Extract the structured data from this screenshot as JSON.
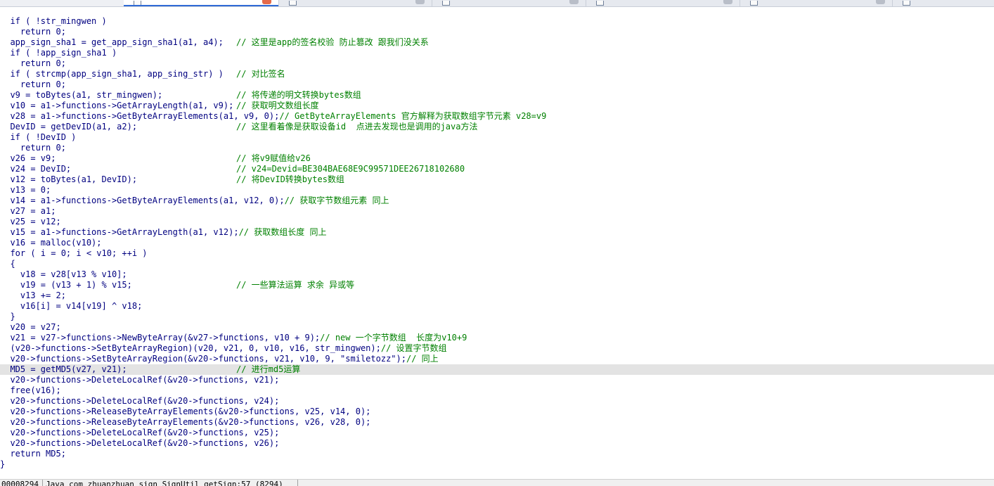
{
  "tabs": [
    {
      "label": "",
      "active": true
    },
    {
      "label": "",
      "active": false
    },
    {
      "label": "",
      "active": false
    },
    {
      "label": "",
      "active": false
    },
    {
      "label": "",
      "active": false
    },
    {
      "label": "",
      "active": false
    }
  ],
  "code_lines": [
    {
      "code": "  if ( !str_mingwen )",
      "comment": ""
    },
    {
      "code": "    return 0;",
      "comment": ""
    },
    {
      "code": "  app_sign_sha1 = get_app_sign_sha1(a1, a4);",
      "comment": "// 这里是app的签名校验 防止篡改 跟我们没关系"
    },
    {
      "code": "  if ( !app_sign_sha1 )",
      "comment": ""
    },
    {
      "code": "    return 0;",
      "comment": ""
    },
    {
      "code": "  if ( strcmp(app_sign_sha1, app_sing_str) )",
      "comment": "// 对比签名"
    },
    {
      "code": "    return 0;",
      "comment": ""
    },
    {
      "code": "  v9 = toBytes(a1, str_mingwen);",
      "comment": "// 将传递的明文转换bytes数组"
    },
    {
      "code": "  v10 = a1->functions->GetArrayLength(a1, v9);",
      "comment": "// 获取明文数组长度"
    },
    {
      "code": "  v28 = a1->functions->GetByteArrayElements(a1, v9, 0);",
      "comment": "// GetByteArrayElements 官方解释为获取数组字节元素 v28=v9",
      "near": true
    },
    {
      "code": "  DevID = getDevID(a1, a2);",
      "comment": "// 这里看着像是获取设备id  点进去发现也是调用的java方法"
    },
    {
      "code": "  if ( !DevID )",
      "comment": ""
    },
    {
      "code": "    return 0;",
      "comment": ""
    },
    {
      "code": "  v26 = v9;",
      "comment": "// 将v9赋值给v26"
    },
    {
      "code": "  v24 = DevID;",
      "comment": "// v24=Devid=BE304BAE68E9C99571DEE26718102680"
    },
    {
      "code": "  v12 = toBytes(a1, DevID);",
      "comment": "// 将DevID转换bytes数组"
    },
    {
      "code": "  v13 = 0;",
      "comment": ""
    },
    {
      "code": "  v14 = a1->functions->GetByteArrayElements(a1, v12, 0);",
      "comment": "// 获取字节数组元素 同上",
      "near": true
    },
    {
      "code": "  v27 = a1;",
      "comment": ""
    },
    {
      "code": "  v25 = v12;",
      "comment": ""
    },
    {
      "code": "  v15 = a1->functions->GetArrayLength(a1, v12);",
      "comment": "// 获取数组长度 同上",
      "near": true
    },
    {
      "code": "  v16 = malloc(v10);",
      "comment": ""
    },
    {
      "code": "  for ( i = 0; i < v10; ++i )",
      "comment": ""
    },
    {
      "code": "  {",
      "comment": ""
    },
    {
      "code": "    v18 = v28[v13 % v10];",
      "comment": ""
    },
    {
      "code": "    v19 = (v13 + 1) % v15;",
      "comment": "// 一些算法运算 求余 异或等"
    },
    {
      "code": "    v13 += 2;",
      "comment": ""
    },
    {
      "code": "    v16[i] = v14[v19] ^ v18;",
      "comment": ""
    },
    {
      "code": "  }",
      "comment": ""
    },
    {
      "code": "  v20 = v27;",
      "comment": ""
    },
    {
      "code": "  v21 = v27->functions->NewByteArray(&v27->functions, v10 + 9);",
      "comment": "// new 一个字节数组  长度为v10+9",
      "near": true
    },
    {
      "code": "  (v20->functions->SetByteArrayRegion)(v20, v21, 0, v10, v16, str_mingwen);",
      "comment": "// 设置字节数组",
      "near": true
    },
    {
      "code": "  v20->functions->SetByteArrayRegion(&v20->functions, v21, v10, 9, \"smiletozz\");",
      "comment": "// 同上",
      "near": true
    },
    {
      "code": "  MD5 = getMD5(v27, v21);",
      "comment": "// 进行md5运算",
      "highlight": true
    },
    {
      "code": "  v20->functions->DeleteLocalRef(&v20->functions, v21);",
      "comment": ""
    },
    {
      "code": "  free(v16);",
      "comment": ""
    },
    {
      "code": "  v20->functions->DeleteLocalRef(&v20->functions, v24);",
      "comment": ""
    },
    {
      "code": "  v20->functions->ReleaseByteArrayElements(&v20->functions, v25, v14, 0);",
      "comment": ""
    },
    {
      "code": "  v20->functions->ReleaseByteArrayElements(&v20->functions, v26, v28, 0);",
      "comment": ""
    },
    {
      "code": "  v20->functions->DeleteLocalRef(&v20->functions, v25);",
      "comment": ""
    },
    {
      "code": "  v20->functions->DeleteLocalRef(&v20->functions, v26);",
      "comment": ""
    },
    {
      "code": "  return MD5;",
      "comment": ""
    },
    {
      "code": "}",
      "comment": ""
    }
  ],
  "status": {
    "address": "00008294",
    "location": "Java_com_zhuanzhuan_sign_SignUtil_getSign:57 (8294)"
  },
  "colors": {
    "code_text": "#000080",
    "comment": "#008000",
    "highlight_line": "#e3e3e3"
  }
}
